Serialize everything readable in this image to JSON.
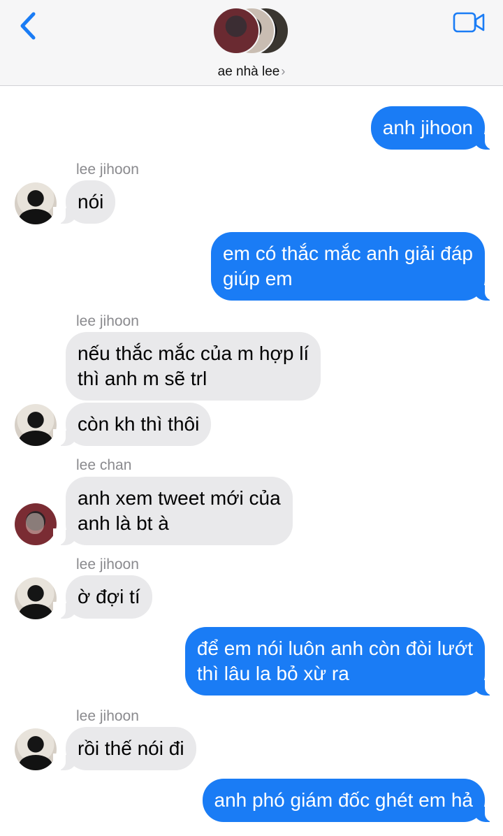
{
  "header": {
    "group_name": "ae nhà lee",
    "chevron": "›",
    "back_icon": "chevron-left-icon",
    "video_icon": "video-camera-icon",
    "accent_color": "#1a7cf5"
  },
  "messages": [
    {
      "direction": "out",
      "text": "anh jihoon"
    },
    {
      "direction": "in",
      "sender": "lee jihoon",
      "text": "nói"
    },
    {
      "direction": "out",
      "text": "em có thắc mắc anh giải đáp\ngiúp em"
    },
    {
      "direction": "in",
      "sender": "lee jihoon",
      "text": "nếu thắc mắc của m hợp lí\nthì anh m sẽ trl"
    },
    {
      "direction": "in",
      "text": "còn kh thì thôi"
    },
    {
      "direction": "in",
      "sender": "lee chan",
      "text": "anh xem tweet mới của\nanh là bt à"
    },
    {
      "direction": "in",
      "sender": "lee jihoon",
      "text": "ờ đợi tí"
    },
    {
      "direction": "out",
      "text": "để em nói luôn anh còn đòi lướt\nthì lâu la bỏ xừ ra"
    },
    {
      "direction": "in",
      "sender": "lee jihoon",
      "text": "rồi thế nói đi"
    },
    {
      "direction": "out",
      "text": "anh phó giám đốc ghét em hả"
    }
  ]
}
